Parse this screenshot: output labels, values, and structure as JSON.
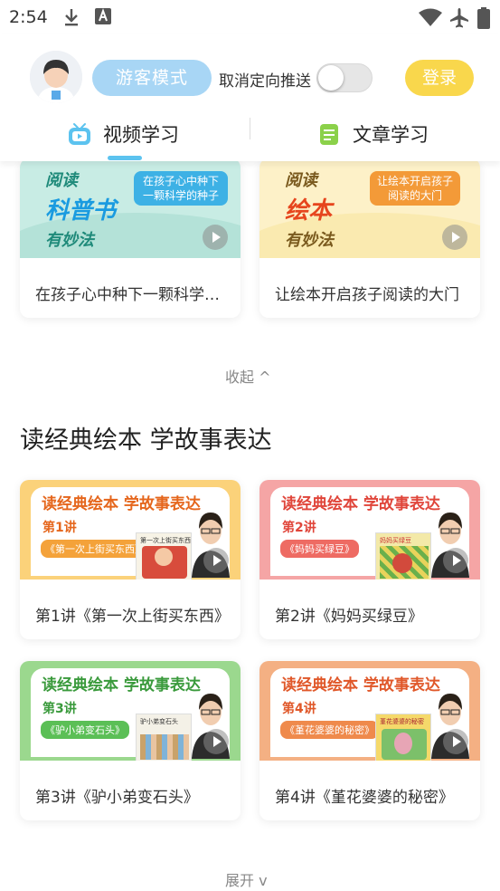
{
  "status_bar": {
    "time": "2:54"
  },
  "header": {
    "guest_mode_label": "游客模式",
    "toggle_label": "取消定向推送",
    "login_label": "登录",
    "tabs": [
      {
        "label": "视频学习",
        "active": true
      },
      {
        "label": "文章学习",
        "active": false
      }
    ]
  },
  "top_cards": [
    {
      "title": "在孩子心中种下一颗科学的种子",
      "thumb_title": [
        "阅读",
        "科普书",
        "有妙法"
      ],
      "thumb_bubble": "在孩子心中种下一颗科学的种子"
    },
    {
      "title": "让绘本开启孩子阅读的大门",
      "thumb_title": [
        "阅读",
        "绘本",
        "有妙法"
      ],
      "thumb_bubble": "让绘本开启孩子阅读的大门"
    }
  ],
  "collapse_label": "收起 ^",
  "section": {
    "title": "读经典绘本 学故事表达",
    "thumb_heading": "读经典绘本  学故事表达",
    "cards": [
      {
        "lecture": "第1讲",
        "book": "《第一次上街买东西》",
        "title": "第1讲《第一次上街买东西》",
        "cover_text": "第一次上街买东西"
      },
      {
        "lecture": "第2讲",
        "book": "《妈妈买绿豆》",
        "title": "第2讲《妈妈买绿豆》",
        "cover_text": "妈妈买绿豆"
      },
      {
        "lecture": "第3讲",
        "book": "《驴小弟变石头》",
        "title": "第3讲《驴小弟变石头》",
        "cover_text": "驴小弟变石头"
      },
      {
        "lecture": "第4讲",
        "book": "《堇花婆婆的秘密》",
        "title": "第4讲《堇花婆婆的秘密》",
        "cover_text": "堇花婆婆的秘密"
      }
    ]
  },
  "expand_label": "展开 v",
  "colors": {
    "guest_btn": "#a8d6f5",
    "login_btn": "#f9d74c",
    "tab_indicator": "#5cc3ef",
    "card_yellow": "#fbd27a",
    "card_pink": "#f5a5a5",
    "card_green": "#9bd88e",
    "card_orange": "#f4b083"
  }
}
